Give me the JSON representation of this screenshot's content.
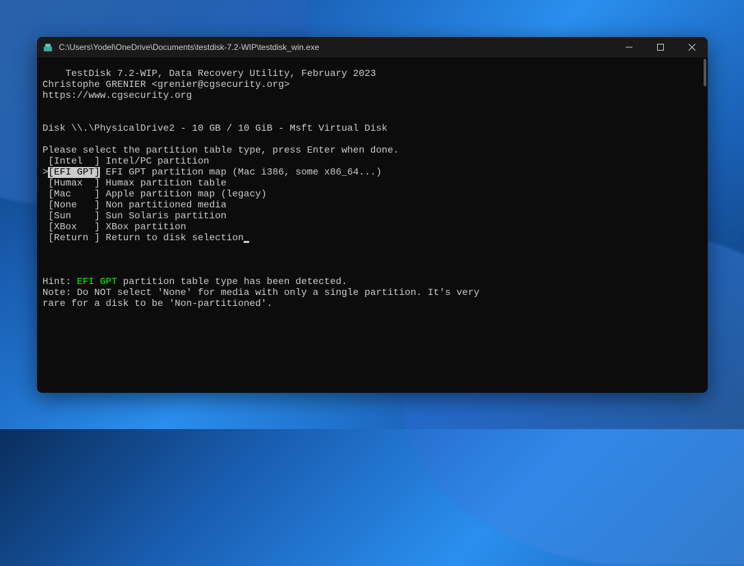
{
  "window": {
    "title": "C:\\Users\\Yodel\\OneDrive\\Documents\\testdisk-7.2-WIP\\testdisk_win.exe"
  },
  "header": {
    "line1": "TestDisk 7.2-WIP, Data Recovery Utility, February 2023",
    "line2": "Christophe GRENIER <grenier@cgsecurity.org>",
    "line3": "https://www.cgsecurity.org"
  },
  "disk_info": "Disk \\\\.\\PhysicalDrive2 - 10 GB / 10 GiB - Msft Virtual Disk",
  "prompt": "Please select the partition table type, press Enter when done.",
  "menu": {
    "intel": {
      "bracket": " [Intel  ] ",
      "label": "Intel/PC partition"
    },
    "efi_pre": ">",
    "efi_gpt": {
      "bracket": "[EFI GPT]",
      "label": " EFI GPT partition map (Mac i386, some x86_64...)"
    },
    "humax": {
      "bracket": " [Humax  ] ",
      "label": "Humax partition table"
    },
    "mac": {
      "bracket": " [Mac    ] ",
      "label": "Apple partition map (legacy)"
    },
    "none": {
      "bracket": " [None   ] ",
      "label": "Non partitioned media"
    },
    "sun": {
      "bracket": " [Sun    ] ",
      "label": "Sun Solaris partition"
    },
    "xbox": {
      "bracket": " [XBox   ] ",
      "label": "XBox partition"
    },
    "return": {
      "bracket": " [Return ] ",
      "label": "Return to disk selection"
    }
  },
  "hint": {
    "prefix": "Hint: ",
    "highlight": "EFI GPT",
    "suffix": " partition table type has been detected."
  },
  "note1": "Note: Do NOT select 'None' for media with only a single partition. It's very",
  "note2": "rare for a disk to be 'Non-partitioned'."
}
